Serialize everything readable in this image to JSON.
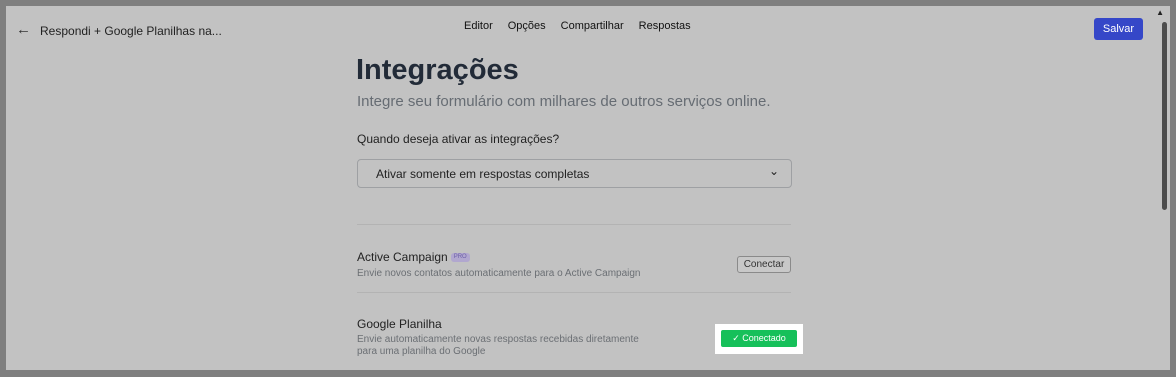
{
  "header": {
    "back_icon": "←",
    "doc_title": "Respondi + Google Planilhas na...",
    "nav": [
      "Editor",
      "Opções",
      "Compartilhar",
      "Respostas"
    ],
    "save_label": "Salvar"
  },
  "page": {
    "title": "Integrações",
    "subtitle": "Integre seu formulário com milhares de outros serviços online.",
    "question": "Quando deseja ativar as integrações?",
    "select_value": "Ativar somente em respostas completas"
  },
  "integrations": [
    {
      "name": "Active Campaign",
      "badge": "PRO",
      "description": "Envie novos contatos automaticamente para o Active Campaign",
      "action_label": "Conectar"
    },
    {
      "name": "Google Planilha",
      "description_line1": "Envie automaticamente novas respostas recebidas diretamente",
      "description_line2": "para uma planilha do Google",
      "action_label": "✓ Conectado"
    }
  ],
  "colors": {
    "accent": "#3547c8",
    "connected": "#16c05a",
    "overlay": "#c2c2c2"
  }
}
